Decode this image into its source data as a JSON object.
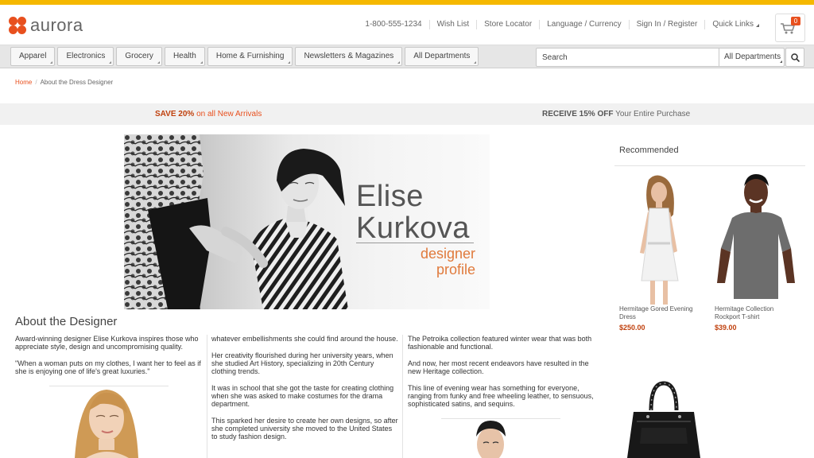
{
  "brand": {
    "name": "aurora",
    "accent_color": "#e8501e",
    "top_bar_color": "#f5b800"
  },
  "utility_nav": {
    "phone": "1-800-555-1234",
    "wish_list": "Wish List",
    "store_locator": "Store Locator",
    "language_currency": "Language / Currency",
    "sign_in": "Sign In / Register",
    "quick_links": "Quick Links"
  },
  "cart": {
    "icon": "cart-icon",
    "count": "0"
  },
  "nav": {
    "items": [
      "Apparel",
      "Electronics",
      "Grocery",
      "Health",
      "Home & Furnishing",
      "Newsletters & Magazines",
      "All Departments"
    ]
  },
  "search": {
    "placeholder": "Search",
    "department": "All Departments",
    "button_icon": "search-icon"
  },
  "breadcrumb": {
    "home": "Home",
    "current": "About the Dress Designer"
  },
  "promo": {
    "left_bold": "SAVE 20%",
    "left_text": " on all New Arrivals",
    "right_bold": "RECEIVE 15% OFF",
    "right_text": " Your Entire Purchase"
  },
  "hero": {
    "name_line1": "Elise",
    "name_line2": "Kurkova",
    "sub_line1": "designer",
    "sub_line2": "profile"
  },
  "about": {
    "title": "About the Designer",
    "col1": [
      "Award-winning designer Elise Kurkova inspires those who appreciate style, design and uncompromising quality.",
      "\"When a woman puts on my clothes, I want her to feel as if she is enjoying one of life's great luxuries.\""
    ],
    "col2": [
      "whatever embellishments she could find around the house.",
      "Her creativity flourished during her university years, when she studied Art History, specializing in 20th Century clothing trends.",
      "It was in school that she got the taste for creating clothing when she was asked to make costumes for the drama department.",
      "This sparked her desire to create her own designs, so after she completed university she moved to the United States to study fashion design."
    ],
    "col3": [
      "The Petroika collection featured winter wear that was both fashionable and functional.",
      "And now, her most recent endeavors have resulted in the new Heritage collection.",
      "This line of evening wear has something for everyone, ranging from funky and free wheeling leather, to sensuous, sophisticated satins, and sequins."
    ]
  },
  "recommended": {
    "title": "Recommended",
    "products": [
      {
        "name": "Hermitage Gored Evening Dress",
        "price": "$250.00"
      },
      {
        "name": "Hermitage Collection Rockport T-shirt",
        "price": "$39.00"
      }
    ]
  }
}
